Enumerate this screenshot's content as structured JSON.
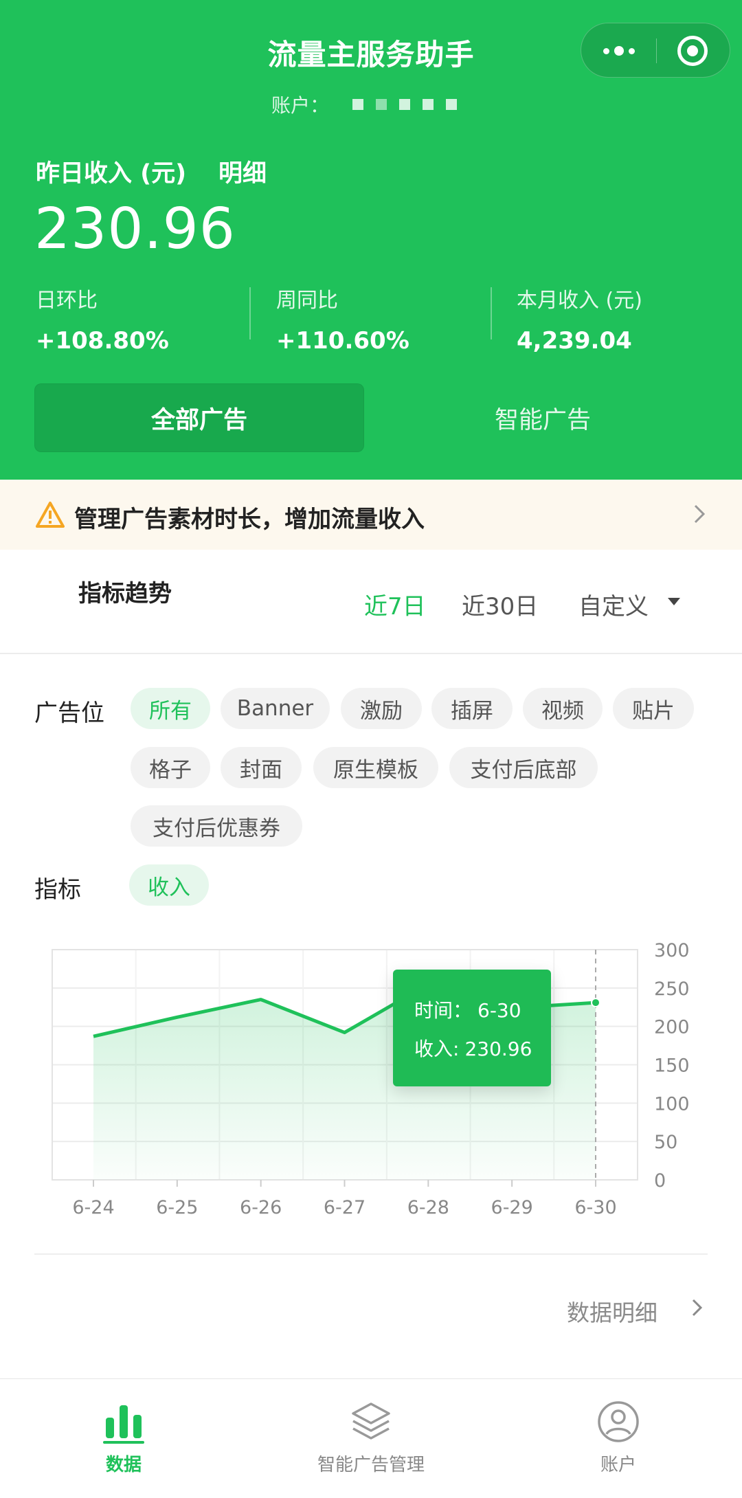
{
  "header": {
    "title": "流量主服务助手",
    "account_label": "账户：",
    "yesterday_label": "昨日收入 (元)",
    "detail_label": "明细",
    "yesterday_value": "230.96",
    "stats": [
      {
        "label": "日环比",
        "value": "+108.80%"
      },
      {
        "label": "周同比",
        "value": "+110.60%"
      },
      {
        "label": "本月收入 (元)",
        "value": "4,239.04"
      }
    ],
    "segments": [
      {
        "label": "全部广告",
        "active": true
      },
      {
        "label": "智能广告",
        "active": false
      }
    ]
  },
  "notice": {
    "text": "管理广告素材时长，增加流量收入"
  },
  "trend": {
    "title": "指标趋势",
    "ranges": [
      {
        "label": "近7日",
        "active": true
      },
      {
        "label": "近30日",
        "active": false
      },
      {
        "label": "自定义",
        "active": false
      }
    ]
  },
  "filters": {
    "slot_label": "广告位",
    "slots": [
      {
        "label": "所有",
        "active": true
      },
      {
        "label": "Banner",
        "active": false
      },
      {
        "label": "激励",
        "active": false
      },
      {
        "label": "插屏",
        "active": false
      },
      {
        "label": "视频",
        "active": false
      },
      {
        "label": "贴片",
        "active": false
      },
      {
        "label": "格子",
        "active": false
      },
      {
        "label": "封面",
        "active": false
      },
      {
        "label": "原生模板",
        "active": false
      },
      {
        "label": "支付后底部",
        "active": false
      },
      {
        "label": "支付后优惠券",
        "active": false
      }
    ],
    "metric_label": "指标",
    "metrics": [
      {
        "label": "收入",
        "active": true
      }
    ]
  },
  "chart_data": {
    "type": "area",
    "x": [
      "6-24",
      "6-25",
      "6-26",
      "6-27",
      "6-28",
      "6-29",
      "6-30"
    ],
    "series": [
      {
        "values": [
          187,
          212,
          235,
          192,
          255,
          224,
          230.96
        ]
      }
    ],
    "ylim": [
      0,
      300
    ],
    "yticks": [
      300,
      250,
      200,
      150,
      100,
      50,
      0
    ],
    "y_axis_side": "right",
    "grid": true,
    "line_color": "#1fc15a",
    "tooltip": {
      "time_label": "时间：",
      "time_value": "6-30",
      "value_label": "收入:",
      "value": "230.96"
    }
  },
  "footer_link": {
    "label": "数据明细"
  },
  "tabbar": [
    {
      "label": "数据",
      "icon": "bar-chart-icon",
      "active": true
    },
    {
      "label": "智能广告管理",
      "icon": "layers-icon",
      "active": false
    },
    {
      "label": "账户",
      "icon": "user-icon",
      "active": false
    }
  ],
  "colors": {
    "brand": "#1fc15a",
    "notice_bg": "#fdf8ee",
    "warning": "#f5a623"
  }
}
